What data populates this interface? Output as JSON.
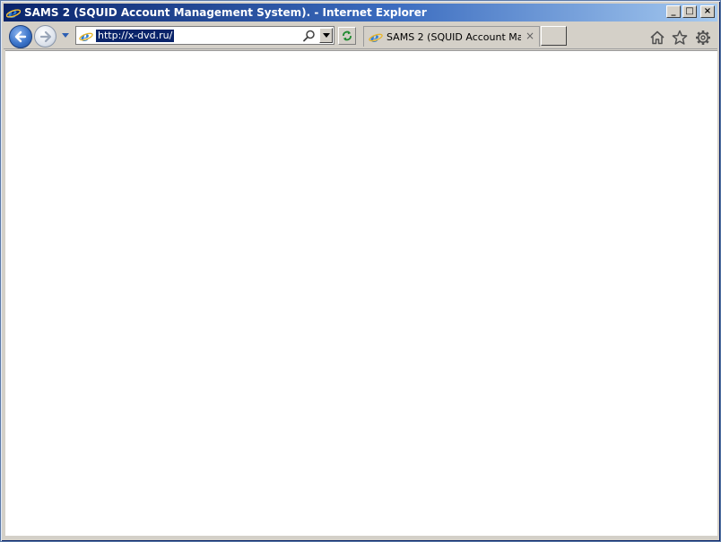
{
  "window": {
    "title": "SAMS 2 (SQUID Account Management System). - Internet Explorer",
    "buttons": {
      "minimize": "_",
      "maximize": "□",
      "close": "×"
    }
  },
  "navbar": {
    "address": {
      "url": "http://x-dvd.ru/"
    },
    "tabs": [
      {
        "title": "SAMS 2 (SQUID Account Ma...",
        "close_glyph": "×"
      }
    ]
  },
  "icons": {
    "app": "ie-icon",
    "back": "back-arrow-icon",
    "forward": "forward-arrow-icon",
    "recent": "chevron-down-icon",
    "search": "search-icon",
    "refresh": "refresh-icon",
    "home": "home-icon",
    "favorites": "star-icon",
    "tools": "gear-icon"
  },
  "colors": {
    "titlebar_start": "#0a246a",
    "titlebar_end": "#a6caf0",
    "selection": "#0a246a",
    "chrome": "#d4d0c8",
    "content": "#ffffff"
  }
}
